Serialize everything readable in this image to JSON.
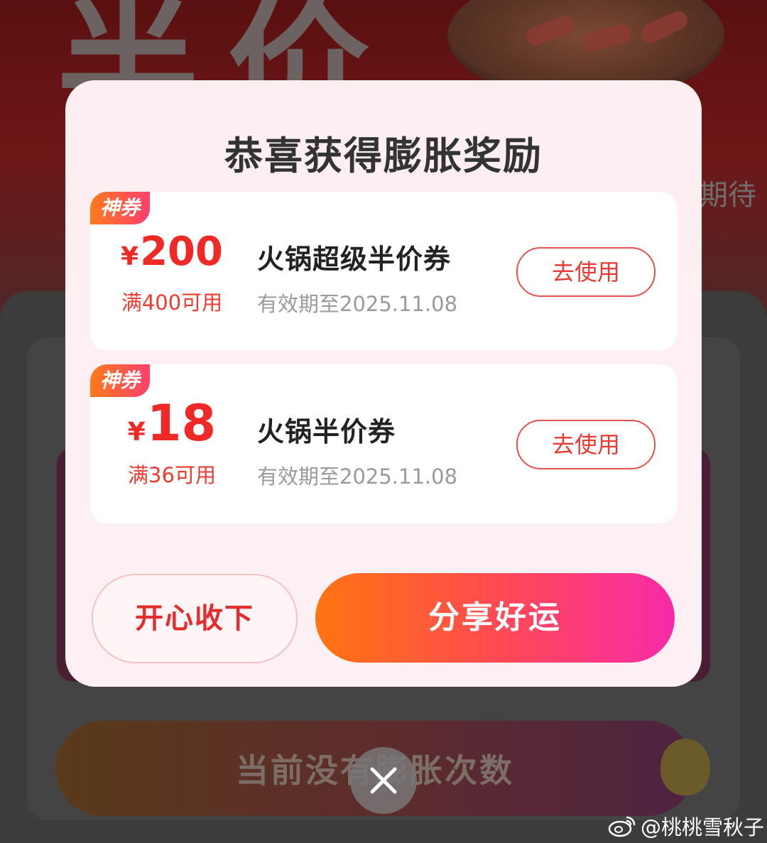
{
  "background": {
    "big_title": "半价",
    "side_text": "期待",
    "bottom_button": "当前没有膨胀次数"
  },
  "modal": {
    "title": "恭喜获得膨胀奖励",
    "coupons": [
      {
        "tag": "神券",
        "currency": "¥",
        "amount": "200",
        "condition": "满400可用",
        "name": "火锅超级半价券",
        "expiry": "有效期至2025.11.08",
        "action": "去使用"
      },
      {
        "tag": "神券",
        "currency": "¥",
        "amount": "18",
        "condition": "满36可用",
        "name": "火锅半价券",
        "expiry": "有效期至2025.11.08",
        "action": "去使用"
      }
    ],
    "accept_label": "开心收下",
    "share_label": "分享好运"
  },
  "watermark": "@桃桃雪秋子",
  "icons": {
    "close": "close-icon",
    "watermark": "weibo-icon"
  },
  "colors": {
    "accent_red": "#ef2a26",
    "share_gradient_start": "#ff7410",
    "share_gradient_end": "#f72aa8",
    "modal_bg": "#fdeef1"
  }
}
